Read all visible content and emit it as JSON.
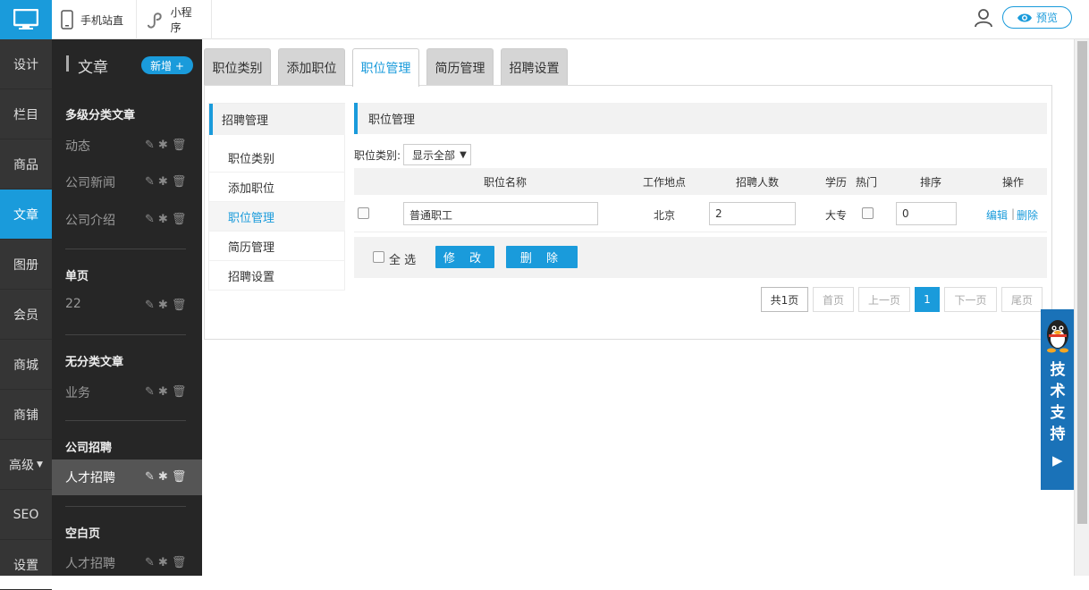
{
  "topbar": {
    "mobile_label": "手机站直",
    "miniapp_label": "小程序",
    "preview_label": "预览"
  },
  "leftnav": {
    "items": [
      "设计",
      "栏目",
      "商品",
      "文章",
      "图册",
      "会员",
      "商城",
      "商铺",
      "高级",
      "SEO",
      "设置"
    ],
    "active": "文章"
  },
  "sidebar": {
    "title": "文章",
    "new_label": "新增 +",
    "groups": [
      {
        "title": "多级分类文章",
        "items": [
          "动态",
          "公司新闻",
          "公司介绍"
        ]
      },
      {
        "title": "单页",
        "items": [
          "22"
        ]
      },
      {
        "title": "无分类文章",
        "items": [
          "业务"
        ]
      },
      {
        "title": "公司招聘",
        "items": [
          "人才招聘"
        ]
      },
      {
        "title": "空白页",
        "items": [
          "人才招聘"
        ]
      }
    ]
  },
  "tabs": [
    "职位类别",
    "添加职位",
    "职位管理",
    "简历管理",
    "招聘设置"
  ],
  "active_tab": "职位管理",
  "left_menu": {
    "title": "招聘管理",
    "items": [
      "职位类别",
      "添加职位",
      "职位管理",
      "简历管理",
      "招聘设置"
    ]
  },
  "content": {
    "title": "职位管理",
    "filter_label": "职位类别:",
    "filter_value": "显示全部",
    "columns": [
      "职位名称",
      "工作地点",
      "招聘人数",
      "学历",
      "热门",
      "排序",
      "操作"
    ],
    "rows": [
      {
        "name": "普通职工",
        "location": "北京",
        "count": "2",
        "education": "大专",
        "order": "0",
        "edit": "编辑",
        "sep": "|",
        "delete": "删除"
      }
    ],
    "select_all": "全 选",
    "modify_btn": "修 改",
    "delete_btn": "删 除"
  },
  "pager": {
    "total": "共1页",
    "first": "首页",
    "prev": "上一页",
    "current": "1",
    "next": "下一页",
    "last": "尾页"
  },
  "support": {
    "text": "技术支持"
  },
  "colors": {
    "accent": "#1a9bdb",
    "nav_bg": "#353535",
    "sidebar_bg": "#262626",
    "support_bg": "#1a72b8"
  }
}
